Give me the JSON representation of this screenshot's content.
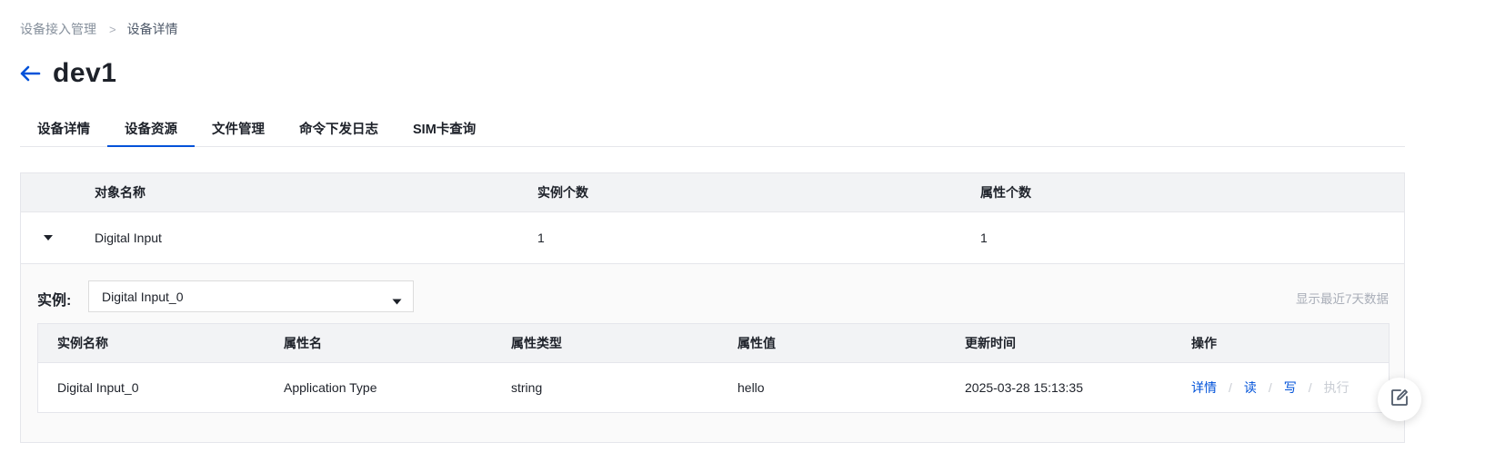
{
  "breadcrumb": {
    "parent": "设备接入管理",
    "separator": ">",
    "current": "设备详情"
  },
  "title": "dev1",
  "tabs": [
    {
      "label": "设备详情",
      "active": false
    },
    {
      "label": "设备资源",
      "active": true
    },
    {
      "label": "文件管理",
      "active": false
    },
    {
      "label": "命令下发日志",
      "active": false
    },
    {
      "label": "SIM卡查询",
      "active": false
    }
  ],
  "object_table": {
    "headers": [
      "对象名称",
      "实例个数",
      "属性个数"
    ],
    "rows": [
      {
        "name": "Digital Input",
        "instance_count": "1",
        "attribute_count": "1",
        "expanded": true
      }
    ]
  },
  "instance_panel": {
    "label": "实例:",
    "selected": "Digital Input_0",
    "note": "显示最近7天数据"
  },
  "attribute_table": {
    "headers": [
      "实例名称",
      "属性名",
      "属性类型",
      "属性值",
      "更新时间",
      "操作"
    ],
    "rows": [
      {
        "instance": "Digital Input_0",
        "attribute": "Application Type",
        "type": "string",
        "value": "hello",
        "updated": "2025-03-28 15:13:35"
      }
    ],
    "actions": {
      "detail": "详情",
      "read": "读",
      "write": "写",
      "execute": "执行",
      "separator": "/"
    }
  },
  "colors": {
    "primary": "#0052d9",
    "text": "#1d2129",
    "muted": "#86909c",
    "disabled": "#c9cdd4",
    "header_bg": "#f2f3f5"
  },
  "icons": {
    "back": "arrow-left-icon",
    "expand": "caret-down-icon",
    "select": "caret-down-icon",
    "fab": "edit-icon"
  }
}
